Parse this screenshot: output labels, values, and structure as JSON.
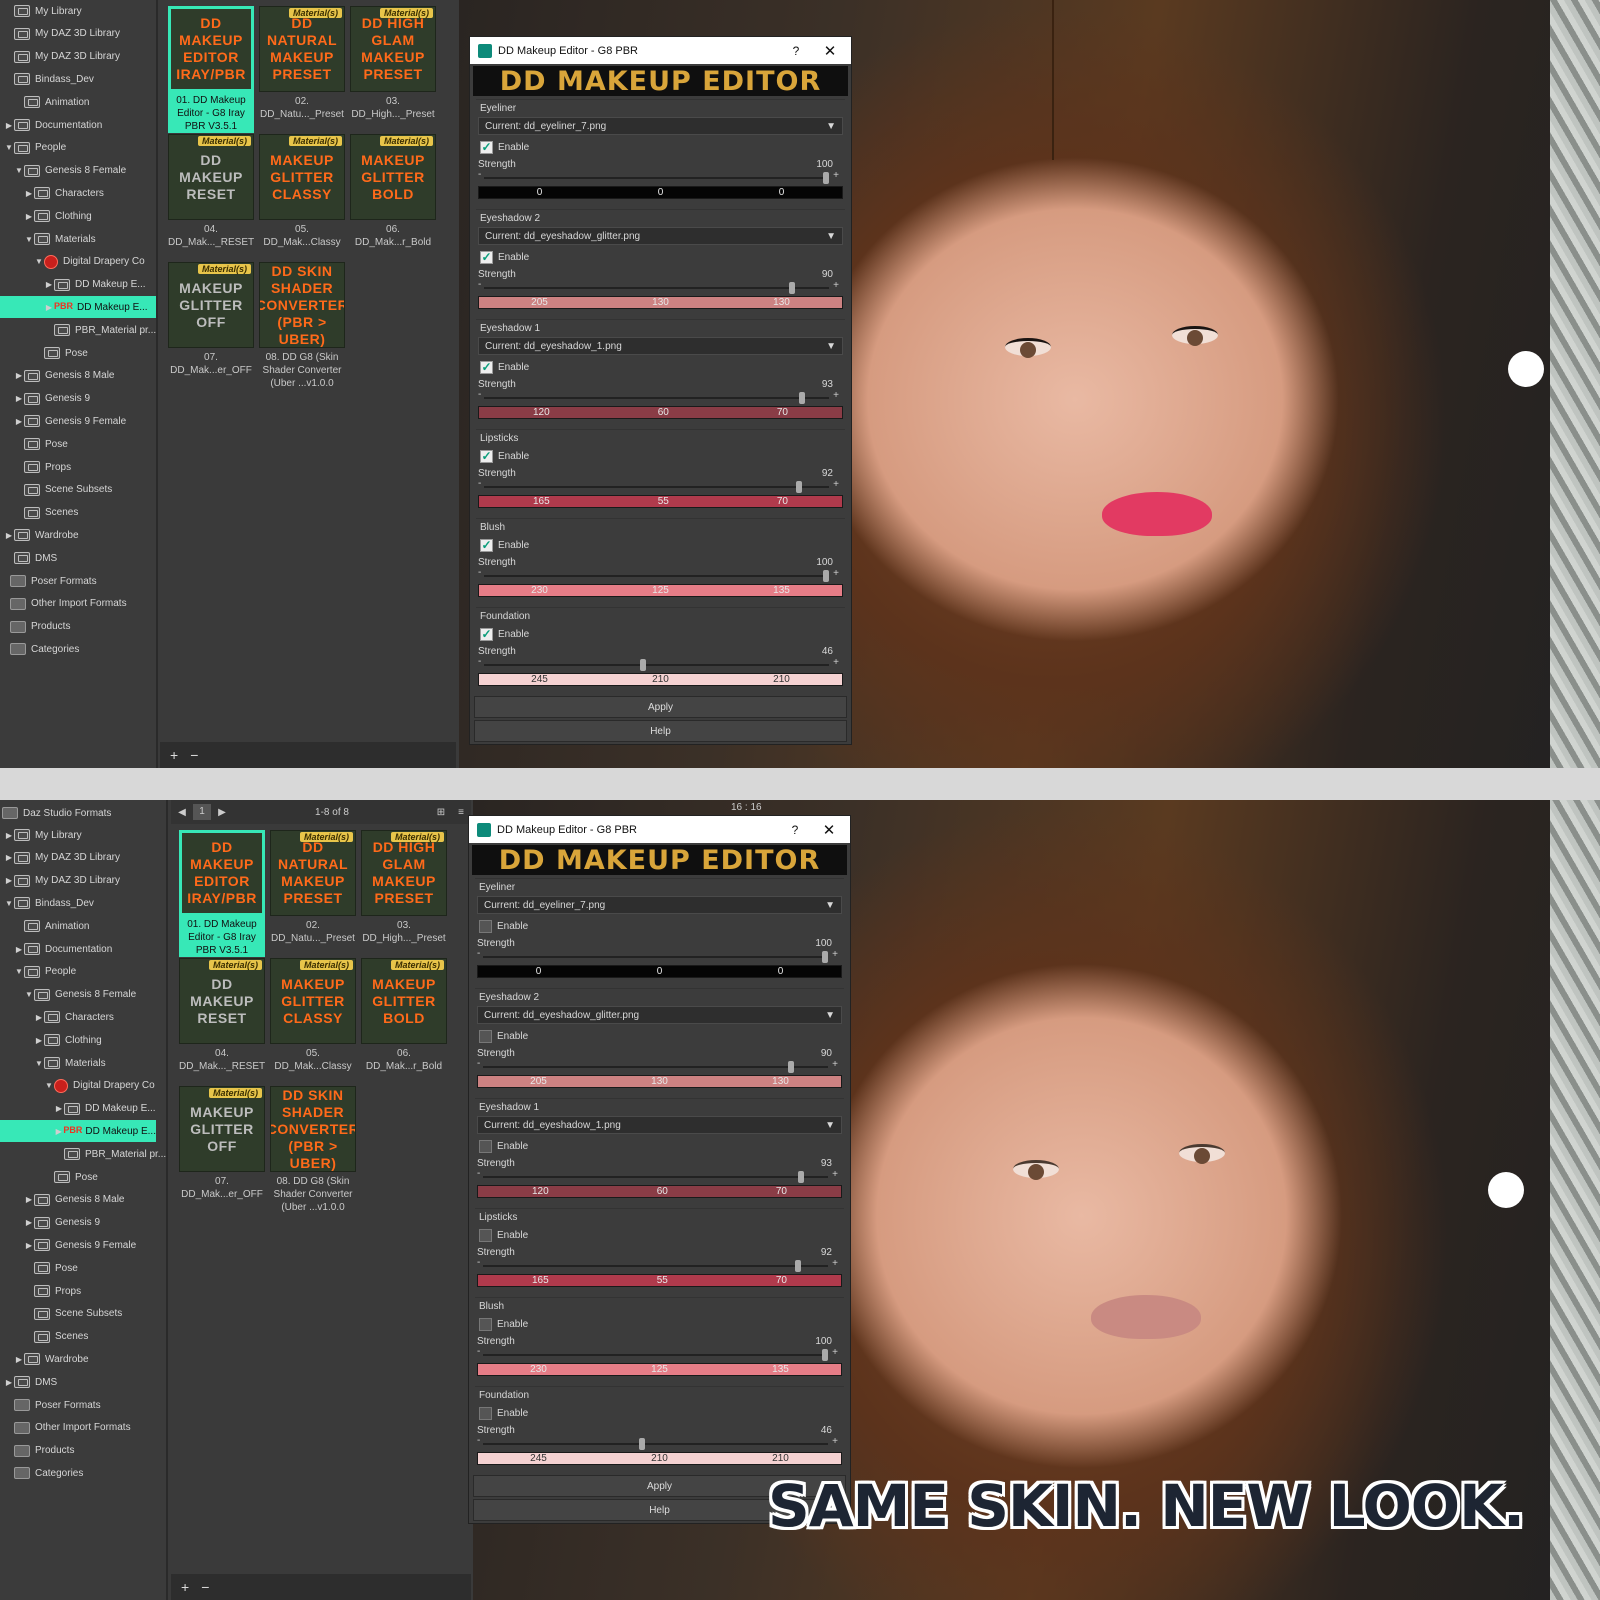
{
  "top": {
    "tree": [
      {
        "label": "My Library",
        "level": 0,
        "arrow": "",
        "icon": "folder"
      },
      {
        "label": "My DAZ 3D Library",
        "level": 0,
        "arrow": "",
        "icon": "folder"
      },
      {
        "label": "My DAZ 3D Library",
        "level": 0,
        "arrow": "",
        "icon": "folder"
      },
      {
        "label": "Bindass_Dev",
        "level": 0,
        "arrow": "",
        "icon": "folder"
      },
      {
        "label": "Animation",
        "level": 1,
        "arrow": "",
        "icon": "folder"
      },
      {
        "label": "Documentation",
        "level": 0,
        "arrow": "▶",
        "icon": "folder"
      },
      {
        "label": "People",
        "level": 0,
        "arrow": "▼",
        "icon": "folder"
      },
      {
        "label": "Genesis 8 Female",
        "level": 1,
        "arrow": "▼",
        "icon": "folder"
      },
      {
        "label": "Characters",
        "level": 2,
        "arrow": "▶",
        "icon": "folder"
      },
      {
        "label": "Clothing",
        "level": 2,
        "arrow": "▶",
        "icon": "folder"
      },
      {
        "label": "Materials",
        "level": 2,
        "arrow": "▼",
        "icon": "folder"
      },
      {
        "label": "Digital Drapery Co",
        "level": 3,
        "arrow": "▼",
        "icon": "red"
      },
      {
        "label": "DD Makeup E...",
        "level": 4,
        "arrow": "▶",
        "icon": "folder"
      },
      {
        "label": "DD Makeup E...",
        "level": 4,
        "arrow": "▶",
        "icon": "pbr",
        "selected": true
      },
      {
        "label": "PBR_Material pr...",
        "level": 4,
        "arrow": "",
        "icon": "folder"
      },
      {
        "label": "Pose",
        "level": 3,
        "arrow": "",
        "icon": "folder"
      },
      {
        "label": "Genesis 8 Male",
        "level": 1,
        "arrow": "▶",
        "icon": "folder"
      },
      {
        "label": "Genesis 9",
        "level": 1,
        "arrow": "▶",
        "icon": "folder"
      },
      {
        "label": "Genesis 9 Female",
        "level": 1,
        "arrow": "▶",
        "icon": "folder"
      },
      {
        "label": "Pose",
        "level": 1,
        "arrow": "",
        "icon": "folder"
      },
      {
        "label": "Props",
        "level": 1,
        "arrow": "",
        "icon": "folder"
      },
      {
        "label": "Scene Subsets",
        "level": 1,
        "arrow": "",
        "icon": "folder"
      },
      {
        "label": "Scenes",
        "level": 1,
        "arrow": "",
        "icon": "folder"
      },
      {
        "label": "Wardrobe",
        "level": 0,
        "arrow": "▶",
        "icon": "folder"
      },
      {
        "label": "DMS",
        "level": 0,
        "arrow": "",
        "icon": "folder"
      },
      {
        "label": "Poser Formats",
        "level": -1,
        "arrow": "",
        "icon": "box"
      },
      {
        "label": "Other Import Formats",
        "level": -1,
        "arrow": "",
        "icon": "box"
      },
      {
        "label": "Products",
        "level": -1,
        "arrow": "",
        "icon": "box"
      },
      {
        "label": "Categories",
        "level": -1,
        "arrow": "",
        "icon": "box"
      }
    ]
  },
  "bottom": {
    "header_label": "Daz Studio Formats",
    "page_number": "1",
    "page_count": "1-8 of 8",
    "viewport_time": "16 : 16",
    "tree": [
      {
        "label": "My Library",
        "level": 0,
        "arrow": "▶",
        "icon": "folder"
      },
      {
        "label": "My DAZ 3D Library",
        "level": 0,
        "arrow": "▶",
        "icon": "folder"
      },
      {
        "label": "My DAZ 3D Library",
        "level": 0,
        "arrow": "▶",
        "icon": "folder"
      },
      {
        "label": "Bindass_Dev",
        "level": 0,
        "arrow": "▼",
        "icon": "folder"
      },
      {
        "label": "Animation",
        "level": 1,
        "arrow": "",
        "icon": "folder"
      },
      {
        "label": "Documentation",
        "level": 1,
        "arrow": "▶",
        "icon": "folder"
      },
      {
        "label": "People",
        "level": 1,
        "arrow": "▼",
        "icon": "folder"
      },
      {
        "label": "Genesis 8 Female",
        "level": 2,
        "arrow": "▼",
        "icon": "folder"
      },
      {
        "label": "Characters",
        "level": 3,
        "arrow": "▶",
        "icon": "folder"
      },
      {
        "label": "Clothing",
        "level": 3,
        "arrow": "▶",
        "icon": "folder"
      },
      {
        "label": "Materials",
        "level": 3,
        "arrow": "▼",
        "icon": "folder"
      },
      {
        "label": "Digital Drapery Co",
        "level": 4,
        "arrow": "▼",
        "icon": "red"
      },
      {
        "label": "DD Makeup E...",
        "level": 5,
        "arrow": "▶",
        "icon": "folder"
      },
      {
        "label": "DD Makeup E...",
        "level": 5,
        "arrow": "▶",
        "icon": "pbr",
        "selected": true
      },
      {
        "label": "PBR_Material pr...",
        "level": 5,
        "arrow": "",
        "icon": "folder"
      },
      {
        "label": "Pose",
        "level": 4,
        "arrow": "",
        "icon": "folder"
      },
      {
        "label": "Genesis 8 Male",
        "level": 2,
        "arrow": "▶",
        "icon": "folder"
      },
      {
        "label": "Genesis 9",
        "level": 2,
        "arrow": "▶",
        "icon": "folder"
      },
      {
        "label": "Genesis 9 Female",
        "level": 2,
        "arrow": "▶",
        "icon": "folder"
      },
      {
        "label": "Pose",
        "level": 2,
        "arrow": "",
        "icon": "folder"
      },
      {
        "label": "Props",
        "level": 2,
        "arrow": "",
        "icon": "folder"
      },
      {
        "label": "Scene Subsets",
        "level": 2,
        "arrow": "",
        "icon": "folder"
      },
      {
        "label": "Scenes",
        "level": 2,
        "arrow": "",
        "icon": "folder"
      },
      {
        "label": "Wardrobe",
        "level": 1,
        "arrow": "▶",
        "icon": "folder"
      },
      {
        "label": "DMS",
        "level": 0,
        "arrow": "▶",
        "icon": "folder"
      },
      {
        "label": "Poser Formats",
        "level": 0,
        "arrow": "",
        "icon": "box"
      },
      {
        "label": "Other Import Formats",
        "level": 0,
        "arrow": "",
        "icon": "box"
      },
      {
        "label": "Products",
        "level": 0,
        "arrow": "",
        "icon": "box"
      },
      {
        "label": "Categories",
        "level": 0,
        "arrow": "",
        "icon": "box"
      }
    ]
  },
  "tiles": [
    {
      "badge": "",
      "lines": [
        "DD MAKEUP",
        "EDITOR",
        "IRAY/PBR"
      ],
      "style": "o",
      "caption": "01. DD Makeup Editor - G8 Iray PBR V3.5.1",
      "selected": true
    },
    {
      "badge": "Material(s)",
      "lines": [
        "DD",
        "NATURAL",
        "MAKEUP",
        "PRESET"
      ],
      "style": "o",
      "caption": "02. DD_Natu..._Preset"
    },
    {
      "badge": "Material(s)",
      "lines": [
        "DD HIGH",
        "GLAM",
        "MAKEUP",
        "PRESET"
      ],
      "style": "o",
      "caption": "03. DD_High..._Preset"
    },
    {
      "badge": "Material(s)",
      "lines": [
        "DD",
        "MAKEUP",
        "RESET"
      ],
      "style": "g",
      "caption": "04. DD_Mak..._RESET"
    },
    {
      "badge": "Material(s)",
      "lines": [
        "MAKEUP",
        "GLITTER",
        "CLASSY"
      ],
      "style": "o",
      "caption": "05. DD_Mak...Classy"
    },
    {
      "badge": "Material(s)",
      "lines": [
        "MAKEUP",
        "GLITTER",
        "BOLD"
      ],
      "style": "o",
      "caption": "06. DD_Mak...r_Bold"
    },
    {
      "badge": "Material(s)",
      "lines": [
        "MAKEUP",
        "GLITTER",
        "OFF"
      ],
      "style": "g",
      "caption": "07. DD_Mak...er_OFF"
    },
    {
      "badge": "",
      "lines": [
        "DD SKIN",
        "SHADER",
        "CONVERTER",
        "(PBR > UBER)"
      ],
      "style": "o",
      "caption": "08. DD G8 (Skin Shader Converter (Uber ...v1.0.0"
    }
  ],
  "dialog": {
    "title": "DD Makeup Editor - G8 PBR",
    "help_glyph": "?",
    "close_glyph": "✕",
    "banner": "DD MAKEUP EDITOR",
    "enable_label": "Enable",
    "strength_label": "Strength",
    "apply_label": "Apply",
    "help_label": "Help",
    "sections": [
      {
        "name": "Eyeliner",
        "current": "Current: dd_eyeliner_7.png",
        "strength": "100",
        "level": 1.0,
        "rgb": [
          "0",
          "0",
          "0"
        ],
        "color": "#050505"
      },
      {
        "name": "Eyeshadow 2",
        "current": "Current: dd_eyeshadow_glitter.png",
        "strength": "90",
        "level": 0.9,
        "rgb": [
          "205",
          "130",
          "130"
        ],
        "color": "#cd8282"
      },
      {
        "name": "Eyeshadow 1",
        "current": "Current: dd_eyeshadow_1.png",
        "strength": "93",
        "level": 0.93,
        "rgb": [
          "120",
          "60",
          "70"
        ],
        "color": "#8a3c46"
      },
      {
        "name": "Lipsticks",
        "current": "",
        "strength": "92",
        "level": 0.92,
        "rgb": [
          "165",
          "55",
          "70"
        ],
        "color": "#b03a4c"
      },
      {
        "name": "Blush",
        "current": "",
        "strength": "100",
        "level": 1.0,
        "rgb": [
          "230",
          "125",
          "135"
        ],
        "color": "#e67d87"
      },
      {
        "name": "Foundation",
        "current": "",
        "strength": "46",
        "level": 0.46,
        "rgb": [
          "245",
          "210",
          "210"
        ],
        "color": "#f5d2d2"
      }
    ]
  },
  "slogan": "SAME SKIN. NEW LOOK.",
  "colors": {
    "accent": "#37e8b7",
    "banner_gold": "#d9a53a",
    "lip_top": "#e23a62",
    "lip_bottom": "#c98a82"
  }
}
